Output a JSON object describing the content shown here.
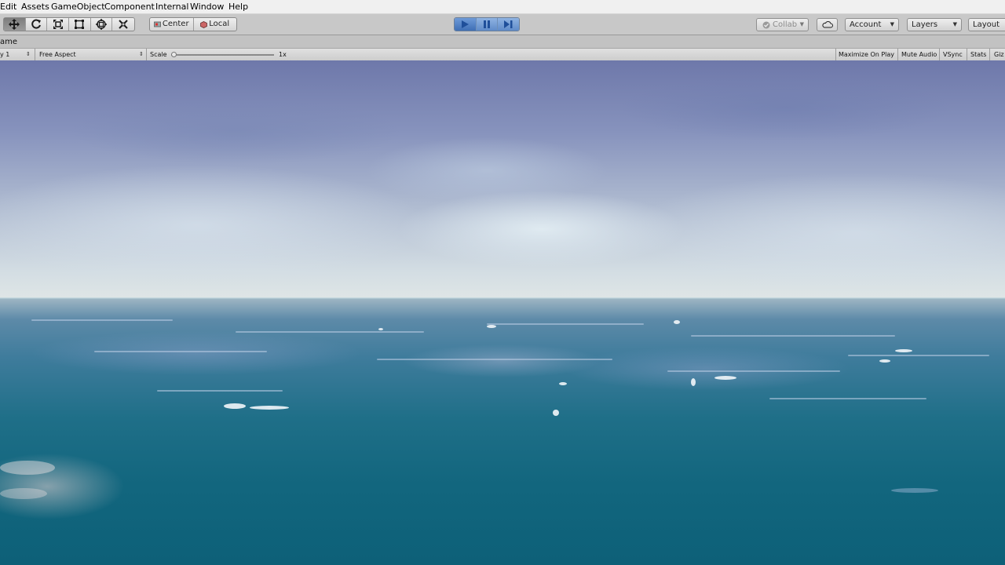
{
  "menu": {
    "items": [
      {
        "label": "Edit"
      },
      {
        "label": "Assets"
      },
      {
        "label": "GameObject"
      },
      {
        "label": "Component"
      },
      {
        "label": "Internal"
      },
      {
        "label": "Window"
      },
      {
        "label": "Help"
      }
    ]
  },
  "toolbar": {
    "tools": [
      {
        "icon": "move-tool-icon",
        "active": true
      },
      {
        "icon": "rotate-tool-icon"
      },
      {
        "icon": "scale-tool-icon"
      },
      {
        "icon": "rect-tool-icon"
      },
      {
        "icon": "transform-tool-icon"
      },
      {
        "icon": "custom-tool-icon"
      }
    ],
    "pivot_label": "Center",
    "space_label": "Local",
    "collab_label": "Collab",
    "account_label": "Account",
    "layers_label": "Layers",
    "layout_label": "Layout",
    "accent_color": "#4a7cc7"
  },
  "game_view": {
    "tab_label": "ame",
    "display_label": "y 1",
    "aspect_label": "Free Aspect",
    "scale_label": "Scale",
    "scale_value": "1x",
    "maximize_label": "Maximize On Play",
    "mute_label": "Mute Audio",
    "vsync_label": "VSync",
    "stats_label": "Stats",
    "gizmos_label": "Giz"
  },
  "scene": {
    "sky_color": "#8793bd",
    "sea_color": "#1f6f88"
  }
}
